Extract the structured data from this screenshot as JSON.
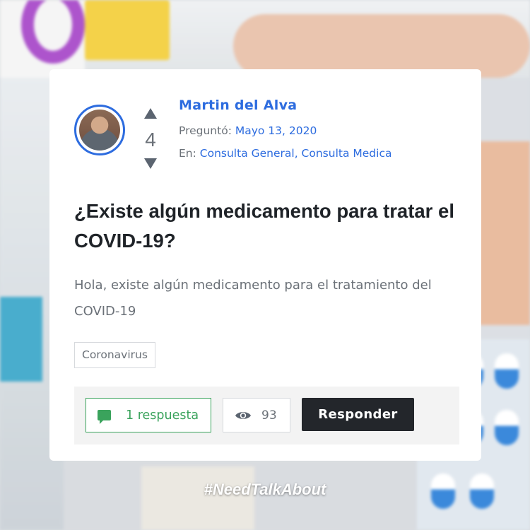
{
  "question": {
    "author": "Martin del Alva",
    "votes": "4",
    "asked_label": "Preguntó:",
    "asked_date": "Mayo 13, 2020",
    "in_label": "En:",
    "categories": "Consulta General, Consulta Medica",
    "title": "¿Existe algún medicamento para tratar el COVID-19?",
    "body": "Hola, existe algún medicamento para el tratamiento del COVID-19",
    "tag": "Coronavirus"
  },
  "footer": {
    "answers_label": "1 respuesta",
    "views_count": "93",
    "reply_label": "Responder"
  },
  "hashtag": "#NeedTalkAbout",
  "icons": {
    "upvote": "triangle-up-icon",
    "downvote": "triangle-down-icon",
    "answers": "comment-icon",
    "views": "eye-icon"
  },
  "colors": {
    "accent": "#2d6cdf",
    "answers_green": "#3aa35c",
    "reply_bg": "#23262b"
  }
}
